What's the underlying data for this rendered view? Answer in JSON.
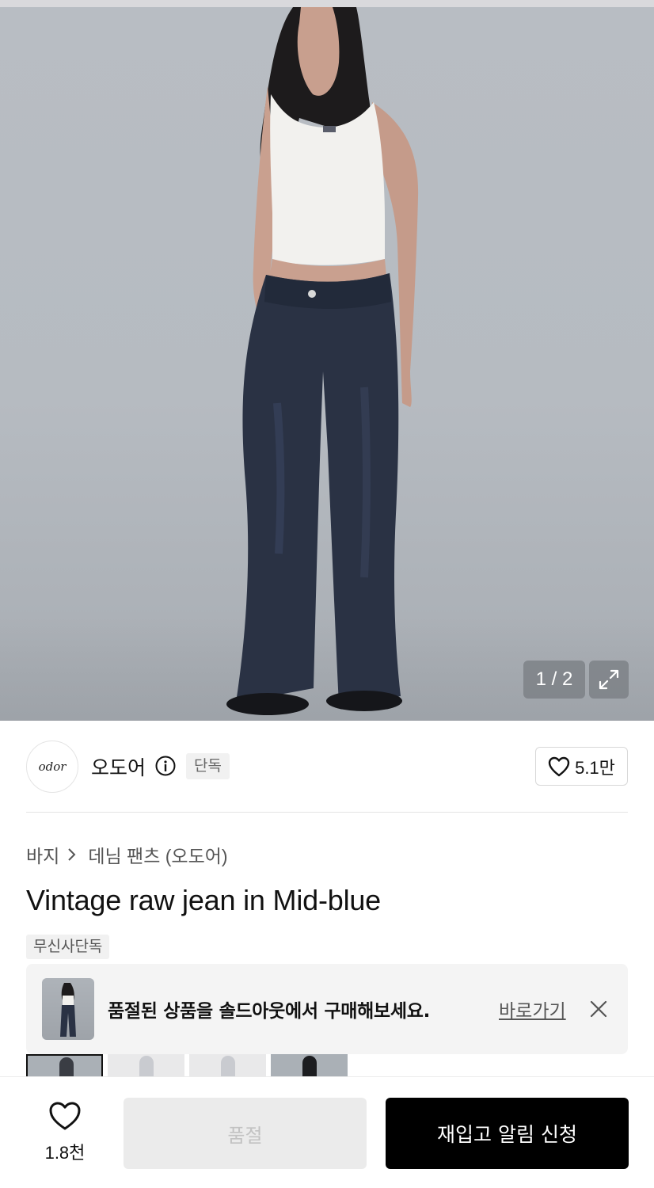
{
  "gallery": {
    "counter": "1 / 2",
    "product_image": "model-wearing-white-tank-and-dark-flared-jeans"
  },
  "brand": {
    "logo_text": "odor",
    "name": "오도어",
    "badge": "단독",
    "like_count": "5.1만"
  },
  "breadcrumb": {
    "category": "바지",
    "subcategory": "데님 팬츠 (오도어)"
  },
  "product": {
    "title": "Vintage raw jean in Mid-blue",
    "tag": "무신사단독"
  },
  "banner": {
    "message": "품절된 상품을 솔드아웃에서 구매해보세요.",
    "link": "바로가기"
  },
  "bottom_bar": {
    "wish_count": "1.8천",
    "soldout_label": "품절",
    "restock_label": "재입고 알림 신청"
  },
  "colors": {
    "primary_button": "#000000",
    "disabled_button": "#ebebeb",
    "badge_bg": "#f1f1f1"
  }
}
